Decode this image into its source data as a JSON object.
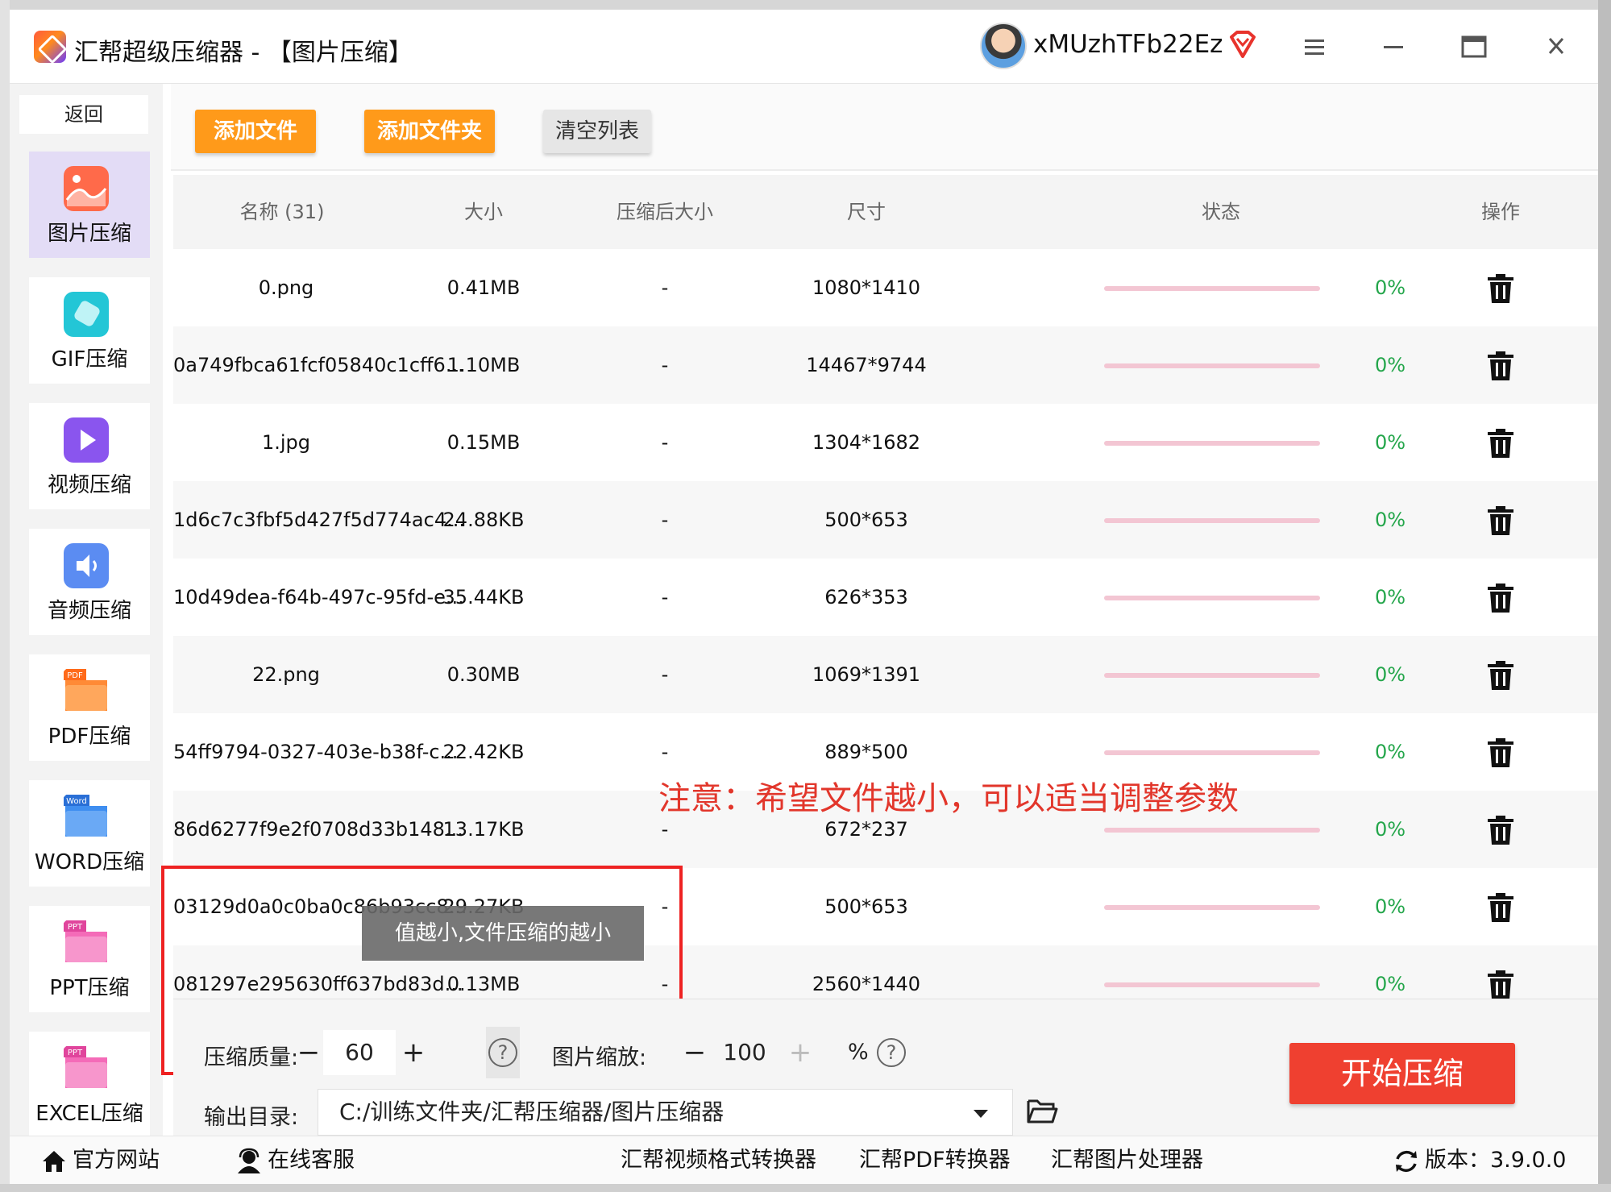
{
  "app": {
    "title": "汇帮超级压缩器  -  【图片压缩】",
    "username": "xMUzhTFb22Ez"
  },
  "sidebar": {
    "back": "返回",
    "items": [
      {
        "label": "图片压缩",
        "icon": "image-icon",
        "color": "#ff6a4a",
        "active": true
      },
      {
        "label": "GIF压缩",
        "icon": "gif-icon",
        "color": "#23c6d6",
        "active": false
      },
      {
        "label": "视频压缩",
        "icon": "video-icon",
        "color": "#8a55ee",
        "active": false
      },
      {
        "label": "音频压缩",
        "icon": "audio-icon",
        "color": "#5b8cf2",
        "active": false
      },
      {
        "label": "PDF压缩",
        "icon": "pdf-icon",
        "color": "#ff8a36",
        "active": false
      },
      {
        "label": "WORD压缩",
        "icon": "word-icon",
        "color": "#3f8ef0",
        "active": false
      },
      {
        "label": "PPT压缩",
        "icon": "ppt-icon",
        "color": "#f46bb8",
        "active": false
      },
      {
        "label": "EXCEL压缩",
        "icon": "excel-icon",
        "color": "#f46bb8",
        "active": false
      }
    ],
    "badges": {
      "pdf": "PDF",
      "word": "Word",
      "ppt": "PPT",
      "excel": "PPT"
    }
  },
  "toolbar": {
    "add_file": "添加文件",
    "add_folder": "添加文件夹",
    "clear_list": "清空列表"
  },
  "table": {
    "headers": [
      "名称 (31)",
      "大小",
      "压缩后大小",
      "尺寸",
      "状态",
      "操作"
    ],
    "rows": [
      {
        "name": "0.png",
        "size": "0.41MB",
        "compressed": "-",
        "dims": "1080*1410",
        "progress": "0%"
      },
      {
        "name": "0a749fbca61fcf05840c1cff6...",
        "size": "1.10MB",
        "compressed": "-",
        "dims": "14467*9744",
        "progress": "0%"
      },
      {
        "name": "1.jpg",
        "size": "0.15MB",
        "compressed": "-",
        "dims": "1304*1682",
        "progress": "0%"
      },
      {
        "name": "1d6c7c3fbf5d427f5d774ac4...",
        "size": "24.88KB",
        "compressed": "-",
        "dims": "500*653",
        "progress": "0%"
      },
      {
        "name": "10d49dea-f64b-497c-95fd-e...",
        "size": "35.44KB",
        "compressed": "-",
        "dims": "626*353",
        "progress": "0%"
      },
      {
        "name": "22.png",
        "size": "0.30MB",
        "compressed": "-",
        "dims": "1069*1391",
        "progress": "0%"
      },
      {
        "name": "54ff9794-0327-403e-b38f-c...",
        "size": "22.42KB",
        "compressed": "-",
        "dims": "889*500",
        "progress": "0%"
      },
      {
        "name": "86d6277f9e2f0708d33b148...",
        "size": "13.17KB",
        "compressed": "-",
        "dims": "672*237",
        "progress": "0%"
      },
      {
        "name": "03129d0a0c0ba0c86b93cc8...",
        "size": "29.27KB",
        "compressed": "-",
        "dims": "500*653",
        "progress": "0%"
      },
      {
        "name": "081297e295630ff637bd83d...",
        "size": "0.13MB",
        "compressed": "-",
        "dims": "2560*1440",
        "progress": "0%"
      }
    ]
  },
  "tooltip": "值越小,文件压缩的越小",
  "annotation": "注意：希望文件越小，可以适当调整参数",
  "settings": {
    "quality_label": "压缩质量:",
    "quality_value": "60",
    "scale_label": "图片缩放:",
    "scale_value": "100",
    "scale_unit": "%",
    "help": "?",
    "minus": "−",
    "plus": "+",
    "output_label": "输出目录:",
    "output_path": "C:/训练文件夹/汇帮压缩器/图片压缩器",
    "start": "开始压缩"
  },
  "footer": {
    "website": "官方网站",
    "service": "在线客服",
    "link1": "汇帮视频格式转换器",
    "link2": "汇帮PDF转换器",
    "link3": "汇帮图片处理器",
    "version": "版本：3.9.0.0"
  },
  "colors": {
    "accent_orange": "#ff9a1a",
    "start_red": "#ef4030",
    "progress_green": "#24a64b",
    "annotation_red": "#e2362b"
  }
}
